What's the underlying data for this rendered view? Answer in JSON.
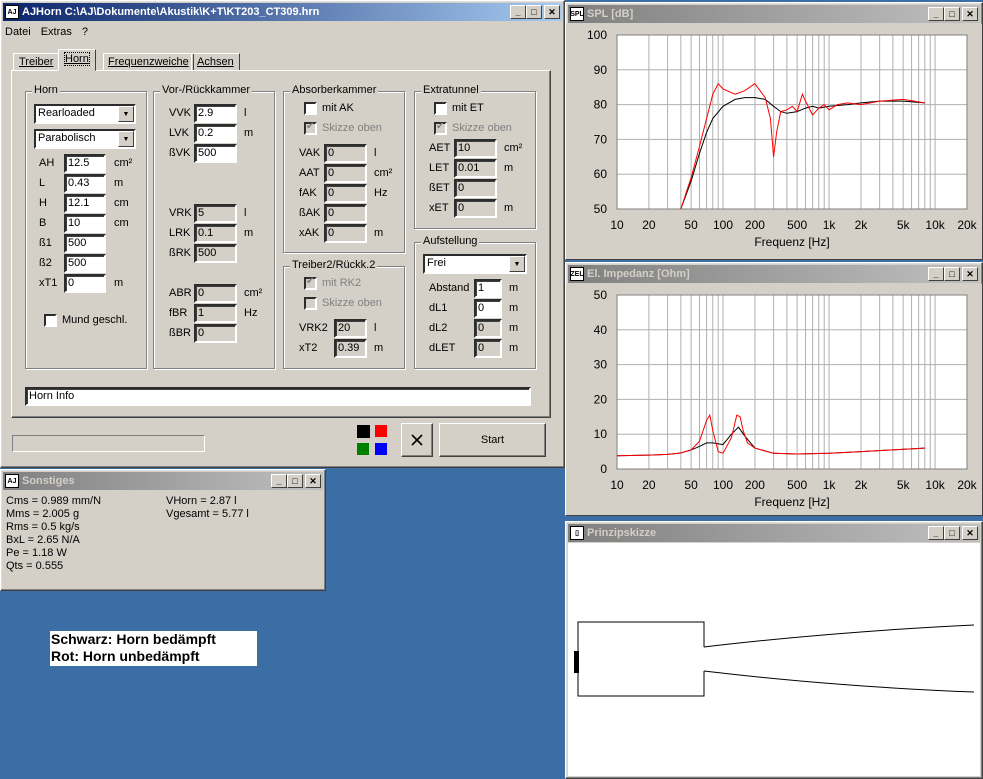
{
  "main": {
    "title": "AJHorn  C:\\AJ\\Dokumente\\Akustik\\K+T\\KT203_CT309.hrn",
    "menu": [
      "Datei",
      "Extras",
      "?"
    ],
    "tabs": [
      "Treiber",
      "Horn",
      "Frequenzweiche",
      "Achsen"
    ],
    "active_tab": "Horn",
    "horn": {
      "group": "Horn",
      "type": "Rearloaded",
      "profile": "Parabolisch",
      "rows": [
        {
          "label": "AH",
          "value": "12.5",
          "unit": "cm²"
        },
        {
          "label": "L",
          "value": "0.43",
          "unit": "m"
        },
        {
          "label": "H",
          "value": "12.1",
          "unit": "cm"
        },
        {
          "label": "B",
          "value": "10",
          "unit": "cm"
        },
        {
          "label": "ß1",
          "value": "500",
          "unit": ""
        },
        {
          "label": "ß2",
          "value": "500",
          "unit": ""
        },
        {
          "label": "xT1",
          "value": "0",
          "unit": "m"
        }
      ],
      "mund": "Mund geschl."
    },
    "vor": {
      "group": "Vor-/Rückkammer",
      "rows": [
        {
          "label": "VVK",
          "value": "2.9",
          "unit": "l"
        },
        {
          "label": "LVK",
          "value": "0.2",
          "unit": "m"
        },
        {
          "label": "ßVK",
          "value": "500",
          "unit": ""
        }
      ],
      "rows2": [
        {
          "label": "VRK",
          "value": "5",
          "unit": "l"
        },
        {
          "label": "LRK",
          "value": "0.1",
          "unit": "m"
        },
        {
          "label": "ßRK",
          "value": "500",
          "unit": ""
        }
      ],
      "rows3": [
        {
          "label": "ABR",
          "value": "0",
          "unit": "cm²"
        },
        {
          "label": "fBR",
          "value": "1",
          "unit": "Hz"
        },
        {
          "label": "ßBR",
          "value": "0",
          "unit": ""
        }
      ]
    },
    "absorber": {
      "group": "Absorberkammer",
      "mit": "mit AK",
      "skizze": "Skizze oben",
      "rows": [
        {
          "label": "VAK",
          "value": "0",
          "unit": "l"
        },
        {
          "label": "AAT",
          "value": "0",
          "unit": "cm²"
        },
        {
          "label": "fAK",
          "value": "0",
          "unit": "Hz"
        },
        {
          "label": "ßAK",
          "value": "0",
          "unit": ""
        },
        {
          "label": "xAK",
          "value": "0",
          "unit": "m"
        }
      ]
    },
    "treiber2": {
      "group": "Treiber2/Rückk.2",
      "mit": "mit RK2",
      "skizze": "Skizze oben",
      "rows": [
        {
          "label": "VRK2",
          "value": "20",
          "unit": "l"
        },
        {
          "label": "xT2",
          "value": "0.39",
          "unit": "m"
        }
      ]
    },
    "extra": {
      "group": "Extratunnel",
      "mit": "mit ET",
      "skizze": "Skizze oben",
      "rows": [
        {
          "label": "AET",
          "value": "10",
          "unit": "cm²"
        },
        {
          "label": "LET",
          "value": "0.01",
          "unit": "m"
        },
        {
          "label": "ßET",
          "value": "0",
          "unit": ""
        },
        {
          "label": "xET",
          "value": "0",
          "unit": "m"
        }
      ]
    },
    "aufstellung": {
      "group": "Aufstellung",
      "value": "Frei",
      "rows": [
        {
          "label": "Abstand",
          "value": "1",
          "unit": "m"
        },
        {
          "label": "dL1",
          "value": "0",
          "unit": "m"
        },
        {
          "label": "dL2",
          "value": "0",
          "unit": "m"
        },
        {
          "label": "dLET",
          "value": "0",
          "unit": "m"
        }
      ]
    },
    "info": "Horn Info",
    "start": "Start",
    "colors": [
      "#000000",
      "#ff0000",
      "#008000",
      "#0000ff"
    ]
  },
  "sonstiges": {
    "title": "Sonstiges",
    "left": [
      "Cms = 0.989 mm/N",
      "Mms = 2.005 g",
      "Rms = 0.5 kg/s",
      "BxL = 2.65 N/A",
      "Pe = 1.18 W",
      "Qts = 0.555"
    ],
    "right": [
      "VHorn = 2.87 l",
      "Vgesamt = 5.77 l"
    ]
  },
  "legend": {
    "line1": "Schwarz: Horn bedämpft",
    "line2": "Rot: Horn unbedämpft"
  },
  "skizze": {
    "title": "Prinzipskizze",
    "icon": "skizze-icon"
  },
  "chart_data": [
    {
      "type": "line",
      "title": "SPL [dB]",
      "xlabel": "Frequenz [Hz]",
      "x_scale": "log",
      "xlim": [
        10,
        20000
      ],
      "ylim": [
        50,
        100
      ],
      "xticks": [
        "10",
        "20",
        "50",
        "100",
        "200",
        "500",
        "1k",
        "2k",
        "5k",
        "10k",
        "20k"
      ],
      "yticks": [
        "50",
        "60",
        "70",
        "80",
        "90",
        "100"
      ],
      "series": [
        {
          "color": "#000000",
          "x": [
            40,
            50,
            60,
            70,
            80,
            100,
            130,
            160,
            200,
            250,
            300,
            350,
            400,
            500,
            600,
            700,
            800,
            1000,
            1500,
            2000,
            3000,
            5000,
            8000
          ],
          "y": [
            50,
            58,
            66,
            72,
            76,
            79.5,
            81.5,
            82,
            82,
            81.5,
            79.5,
            78,
            77.5,
            78,
            79,
            79.5,
            79,
            79.5,
            80,
            80.5,
            81,
            81,
            80.5
          ]
        },
        {
          "color": "#ff0000",
          "x": [
            40,
            50,
            60,
            70,
            80,
            90,
            100,
            130,
            160,
            200,
            250,
            280,
            300,
            320,
            350,
            400,
            450,
            500,
            560,
            600,
            700,
            800,
            900,
            1000,
            1200,
            1500,
            2000,
            3000,
            5000,
            8000
          ],
          "y": [
            50,
            59,
            68,
            76,
            83,
            86,
            84.5,
            83,
            84,
            86,
            82,
            76,
            65,
            72,
            78,
            78.5,
            79.5,
            78,
            83,
            81,
            77,
            79,
            80,
            78.5,
            80,
            80.5,
            80,
            81,
            81.5,
            80.5
          ]
        }
      ]
    },
    {
      "type": "line",
      "title": "El. Impedanz [Ohm]",
      "xlabel": "Frequenz [Hz]",
      "x_scale": "log",
      "xlim": [
        10,
        20000
      ],
      "ylim": [
        0,
        50
      ],
      "xticks": [
        "10",
        "20",
        "50",
        "100",
        "200",
        "500",
        "1k",
        "2k",
        "5k",
        "10k",
        "20k"
      ],
      "yticks": [
        "0",
        "10",
        "20",
        "30",
        "40",
        "50"
      ],
      "series": [
        {
          "color": "#000000",
          "x": [
            10,
            20,
            30,
            40,
            50,
            60,
            70,
            80,
            100,
            120,
            140,
            160,
            200,
            300,
            500,
            1000,
            2000,
            4000,
            8000
          ],
          "y": [
            3.8,
            4,
            4.2,
            4.6,
            5.5,
            6.5,
            7.5,
            7.5,
            7,
            10,
            12,
            9.5,
            6,
            4.5,
            4.3,
            4.5,
            5,
            5.5,
            6
          ]
        },
        {
          "color": "#ff0000",
          "x": [
            10,
            20,
            30,
            40,
            50,
            60,
            70,
            75,
            80,
            90,
            100,
            120,
            135,
            145,
            155,
            170,
            200,
            300,
            500,
            1000,
            2000,
            4000,
            8000
          ],
          "y": [
            3.8,
            4,
            4.2,
            4.6,
            5.5,
            8,
            14,
            15.5,
            11,
            5,
            4.5,
            9,
            15.5,
            15,
            11,
            7.5,
            6,
            4.5,
            4.3,
            4.5,
            5,
            5.5,
            6
          ]
        }
      ]
    }
  ]
}
